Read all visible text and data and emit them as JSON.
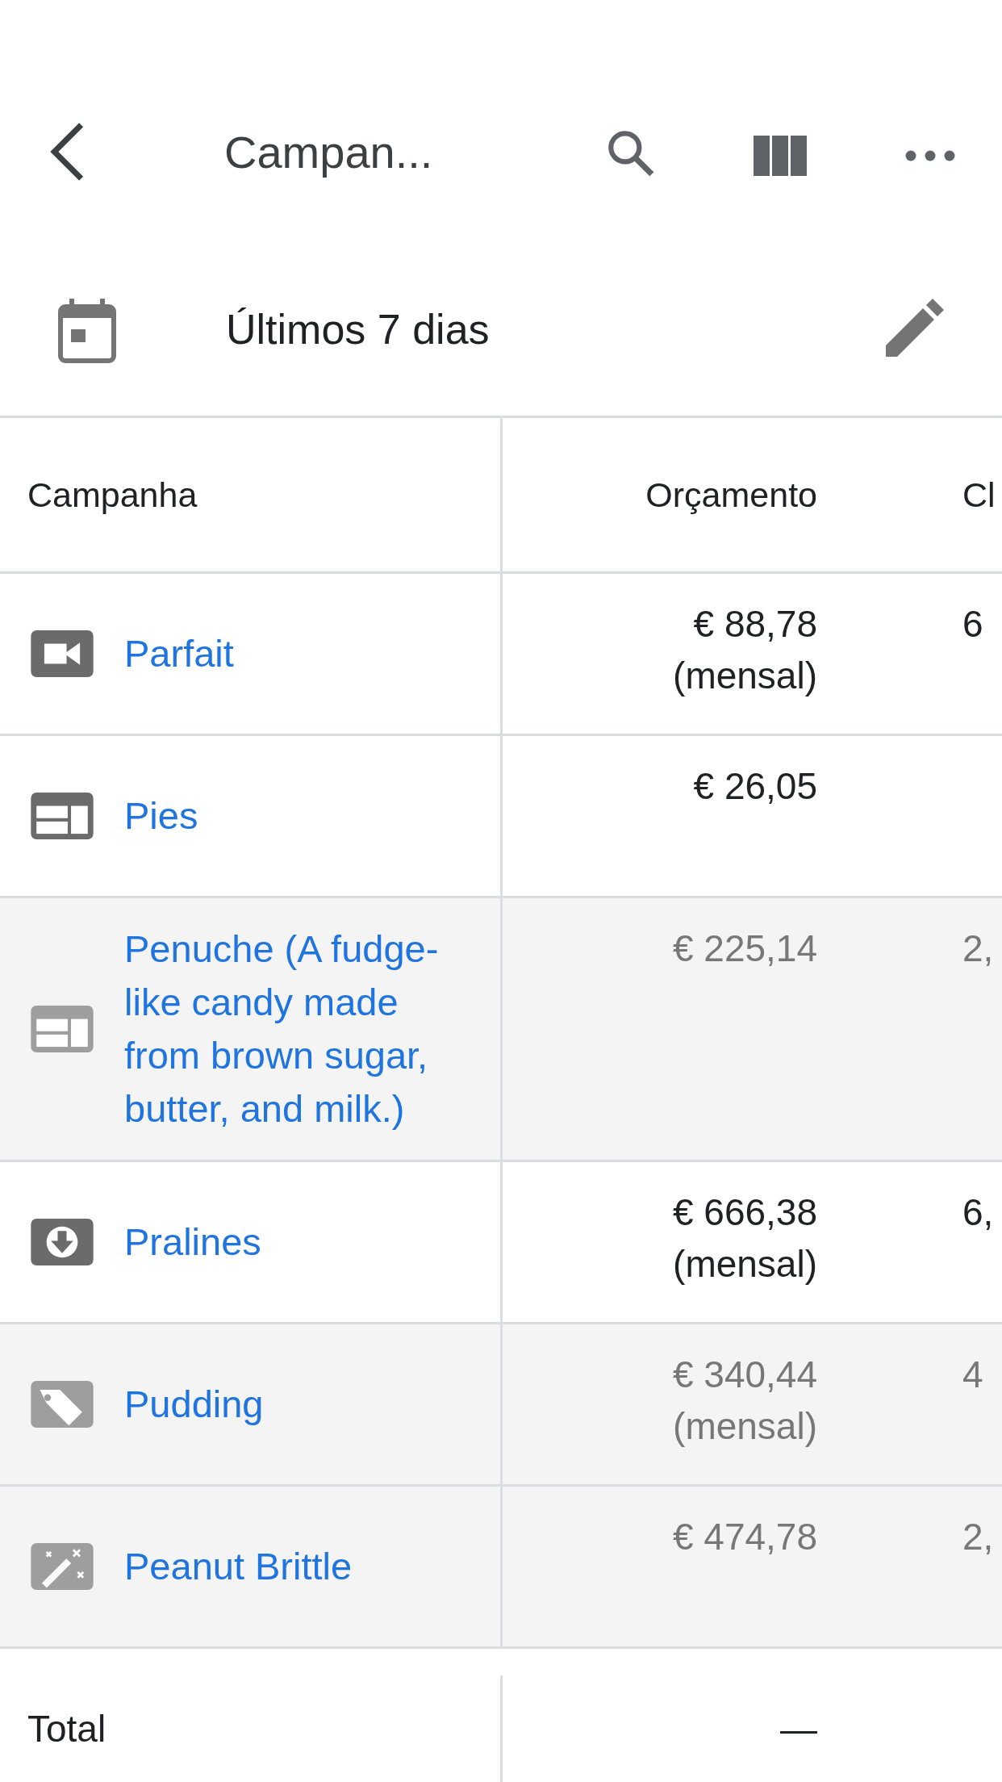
{
  "app_bar": {
    "title": "Campan..."
  },
  "date_range": {
    "label": "Últimos 7 dias"
  },
  "table": {
    "columns": [
      "Campanha",
      "Orçamento",
      "Cl"
    ],
    "rows": [
      {
        "kind": "video",
        "name": "Parfait",
        "budget": "€ 88,78",
        "period": "(mensal)",
        "column_3": "6",
        "disabled": false
      },
      {
        "kind": "display",
        "name": "Pies",
        "budget": "€ 26,05",
        "disabled": false
      },
      {
        "kind": "display",
        "name": "Penuche (A fudge-like candy made from brown sugar, butter, and milk.)",
        "budget": "€ 225,14",
        "column_3": "2,",
        "disabled": true
      },
      {
        "kind": "download",
        "name": "Pralines",
        "budget": "€ 666,38",
        "period": "(mensal)",
        "column_3": "6,",
        "disabled": false
      },
      {
        "kind": "tag",
        "name": "Pudding",
        "budget": "€ 340,44",
        "period": "(mensal)",
        "column_3": "4",
        "disabled": true
      },
      {
        "kind": "wand",
        "name": "Peanut Brittle",
        "budget": "€ 474,78",
        "column_3": "2,",
        "disabled": true
      }
    ],
    "total": {
      "label": "Total",
      "budget": "—"
    }
  }
}
